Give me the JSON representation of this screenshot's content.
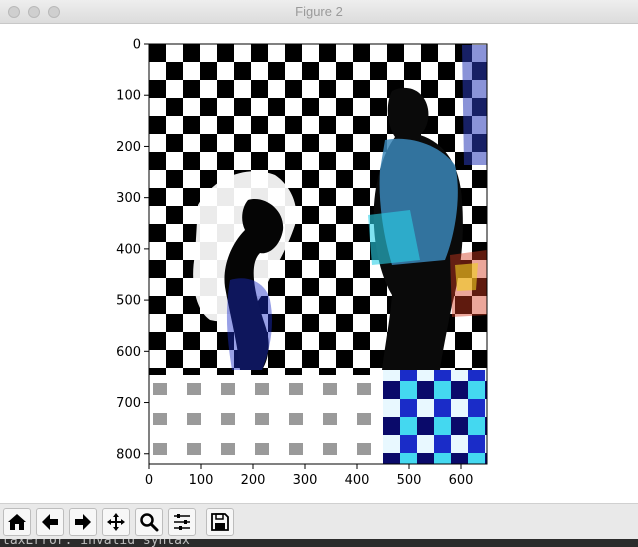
{
  "window": {
    "title": "Figure 2"
  },
  "chart_data": {
    "type": "heatmap",
    "title": "",
    "xlabel": "",
    "ylabel": "",
    "xlim": [
      0,
      650
    ],
    "ylim": [
      820,
      0
    ],
    "x_ticks": [
      0,
      100,
      200,
      300,
      400,
      500,
      600
    ],
    "y_ticks": [
      0,
      100,
      200,
      300,
      400,
      500,
      600,
      700,
      800
    ],
    "x_tick_labels": [
      "0",
      "100",
      "200",
      "300",
      "400",
      "500",
      "600"
    ],
    "y_tick_labels": [
      "0",
      "100",
      "200",
      "300",
      "400",
      "500",
      "600",
      "700",
      "800"
    ],
    "content": "image: photo of people overlaid with a black and white checkerboard pattern",
    "grid": false
  },
  "toolbar": {
    "buttons": [
      {
        "name": "home",
        "icon": "home-icon"
      },
      {
        "name": "back",
        "icon": "arrow-left-icon"
      },
      {
        "name": "forward",
        "icon": "arrow-right-icon"
      },
      {
        "name": "pan",
        "icon": "move-icon"
      },
      {
        "name": "zoom",
        "icon": "zoom-icon"
      },
      {
        "name": "configure-subplots",
        "icon": "sliders-icon"
      },
      {
        "name": "save",
        "icon": "save-icon"
      }
    ]
  },
  "terminal": {
    "text": "taxError: invalid syntax"
  }
}
